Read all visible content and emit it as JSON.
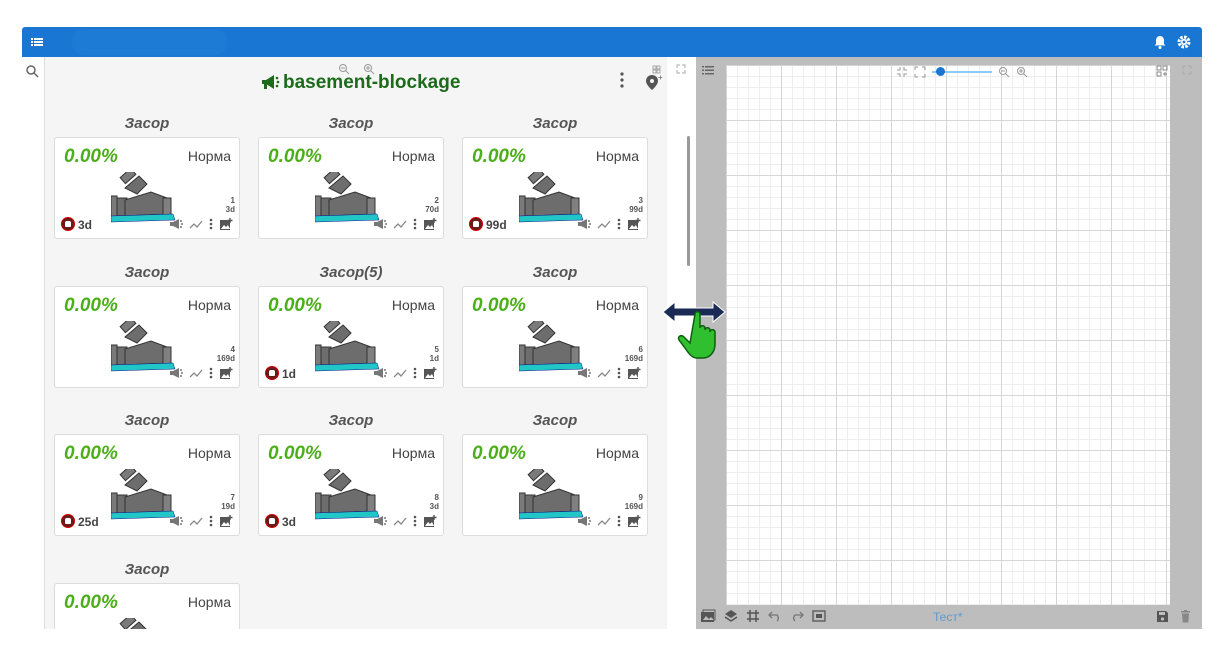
{
  "panel": {
    "title": "basement-blockage"
  },
  "cards": [
    {
      "title": "Засор",
      "value": "0.00%",
      "status": "Норма",
      "id": "1",
      "age": "3d",
      "alarm": "3d"
    },
    {
      "title": "Засор",
      "value": "0.00%",
      "status": "Норма",
      "id": "2",
      "age": "70d",
      "alarm": ""
    },
    {
      "title": "Засор",
      "value": "0.00%",
      "status": "Норма",
      "id": "3",
      "age": "99d",
      "alarm": "99d"
    },
    {
      "title": "Засор",
      "value": "0.00%",
      "status": "Норма",
      "id": "4",
      "age": "169d",
      "alarm": ""
    },
    {
      "title": "Засор(5)",
      "value": "0.00%",
      "status": "Норма",
      "id": "5",
      "age": "1d",
      "alarm": "1d"
    },
    {
      "title": "Засор",
      "value": "0.00%",
      "status": "Норма",
      "id": "6",
      "age": "169d",
      "alarm": ""
    },
    {
      "title": "Засор",
      "value": "0.00%",
      "status": "Норма",
      "id": "7",
      "age": "19d",
      "alarm": "25d"
    },
    {
      "title": "Засор",
      "value": "0.00%",
      "status": "Норма",
      "id": "8",
      "age": "3d",
      "alarm": "3d"
    },
    {
      "title": "Засор",
      "value": "0.00%",
      "status": "Норма",
      "id": "9",
      "age": "169d",
      "alarm": ""
    },
    {
      "title": "Засор",
      "value": "0.00%",
      "status": "Норма",
      "id": "",
      "age": "",
      "alarm": ""
    }
  ],
  "canvas": {
    "document_name": "Тест*"
  },
  "colors": {
    "appbar": "#1976d2",
    "title_green": "#1b6b1b",
    "value_green": "#4caf1a",
    "pipe_gray": "#6d6d6d",
    "pipe_cyan": "#21c7c7",
    "cursor_green": "#2fbf2f"
  },
  "icons": [
    "menu-icon",
    "search-icon",
    "bell-icon",
    "gear-icon",
    "megaphone-icon",
    "kebab-icon",
    "map-pin-icon",
    "trend-icon",
    "image-add-icon",
    "alarm-bell-icon",
    "zoom-in-icon",
    "zoom-out-icon",
    "expand-icon",
    "layers-icon",
    "grid-icon",
    "undo-icon",
    "redo-icon",
    "save-icon",
    "trash-icon",
    "resize-horizontal-cursor-icon"
  ]
}
